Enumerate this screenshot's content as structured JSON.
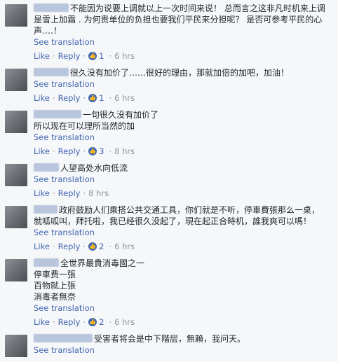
{
  "actions": {
    "like": "Like",
    "reply": "Reply",
    "see_translation": "See translation"
  },
  "comments": [
    {
      "text_lines": [
        "不能因为说要上调就以上一次时间来说！ 总而言之这非凡时机来上调",
        "是雪上加霜 . 为何贵单位的负担也要我们平民来分担呢？ 是否可参考平民的心",
        "声….！"
      ],
      "likes": "1",
      "time": "6 hrs"
    },
    {
      "text_lines": [
        "很久没有加价了……很好的理由，那就加倍的加吧，加油！"
      ],
      "likes": "1",
      "time": "6 hrs"
    },
    {
      "text_lines": [
        "一句很久没有加价了",
        "所以现在可以理所当然的加"
      ],
      "likes": "3",
      "time": "8 hrs"
    },
    {
      "text_lines": [
        "人望高处水向低流"
      ],
      "likes": "",
      "time": "8 hrs"
    },
    {
      "text_lines": [
        "政府鼓励人们乘搭公共交通工具，你们就是不听，停車費張那么一桌，",
        "就呱呱叫，拜托啦，我已经很久没起了，現在起正合時机，誰我爽可以嗎！"
      ],
      "likes": "2",
      "time": "6 hrs"
    },
    {
      "text_lines": [
        "全世界最貴消毒國之一",
        "停車费一張",
        "百物就上張",
        "消毒者無奈"
      ],
      "likes": "2",
      "time": "6 hrs"
    },
    {
      "text_lines": [
        "受害者将会是中下階层，無賴，我问天。"
      ],
      "likes": "",
      "time": ""
    }
  ]
}
